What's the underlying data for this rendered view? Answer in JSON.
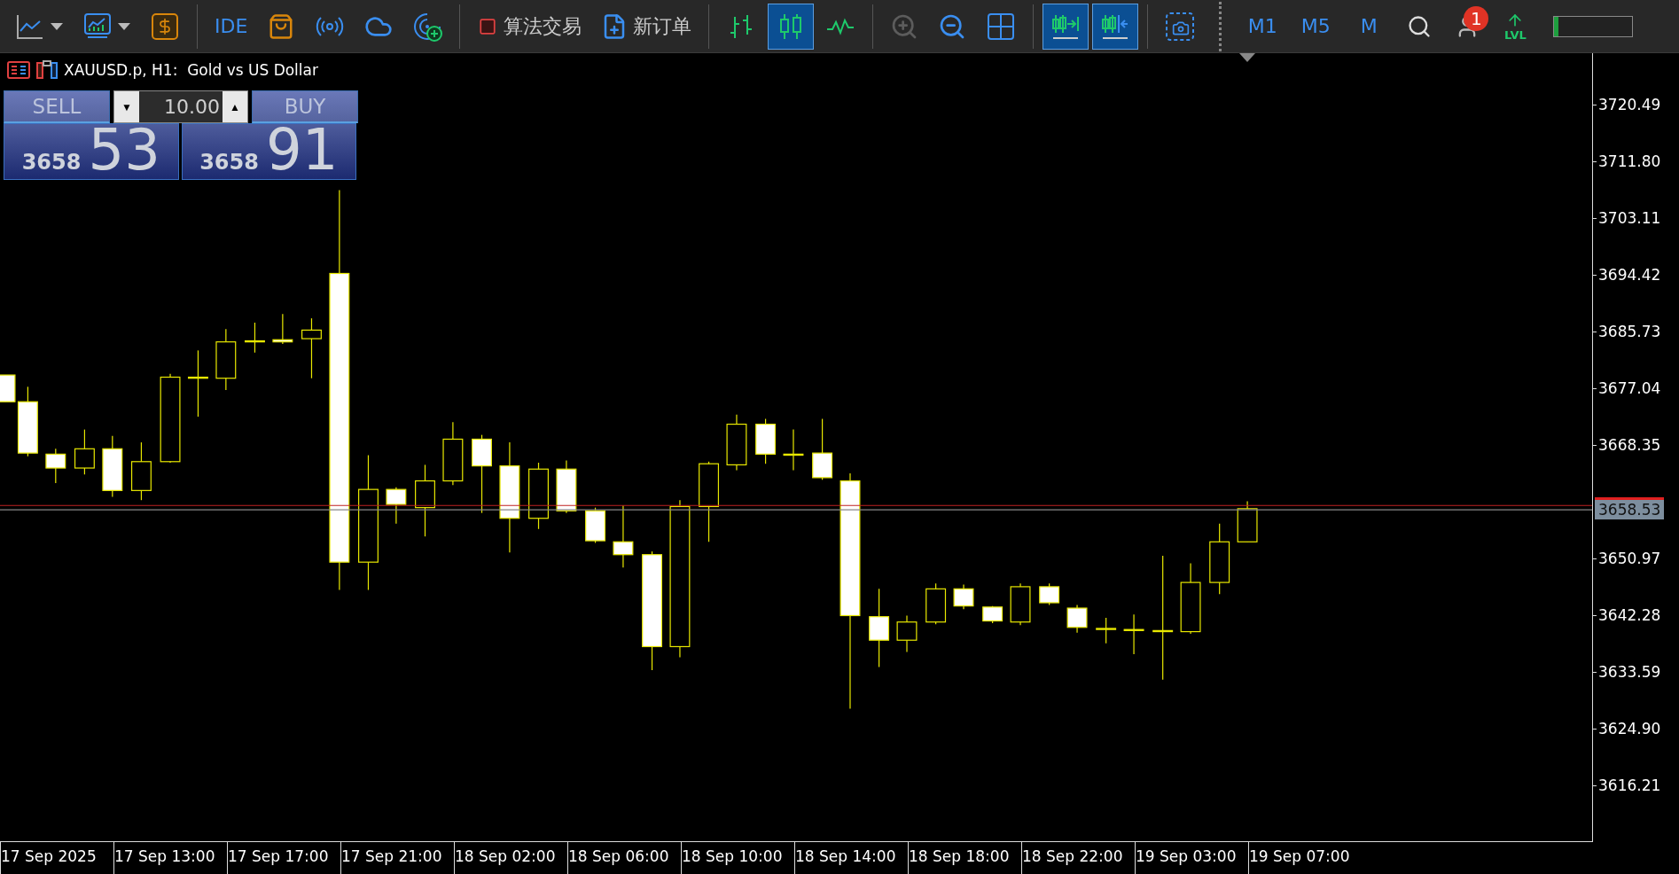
{
  "toolbar": [
    {
      "kind": "linechart",
      "selected": false,
      "disabled": false,
      "dropdown": true
    },
    {
      "kind": "indicators",
      "selected": false,
      "disabled": false,
      "dropdown": true
    },
    {
      "kind": "dollar",
      "selected": false,
      "disabled": false
    },
    {
      "kind": "separator"
    },
    {
      "kind": "text",
      "label": "IDE",
      "selected": false,
      "disabled": false
    },
    {
      "kind": "market",
      "selected": false,
      "disabled": false
    },
    {
      "kind": "signals",
      "selected": false,
      "disabled": false
    },
    {
      "kind": "cloud",
      "selected": false,
      "disabled": false
    },
    {
      "kind": "radar",
      "selected": false,
      "disabled": false
    },
    {
      "kind": "separator"
    },
    {
      "kind": "algo",
      "label": "算法交易",
      "selected": false,
      "disabled": false
    },
    {
      "kind": "neworder",
      "label": "新订单",
      "selected": false,
      "disabled": false
    },
    {
      "kind": "separator"
    },
    {
      "kind": "bars",
      "selected": false,
      "disabled": false
    },
    {
      "kind": "candles",
      "selected": true,
      "disabled": false
    },
    {
      "kind": "line",
      "selected": false,
      "disabled": false
    },
    {
      "kind": "separator"
    },
    {
      "kind": "zoomin",
      "selected": false,
      "disabled": true
    },
    {
      "kind": "zoomout",
      "selected": false,
      "disabled": false
    },
    {
      "kind": "tile",
      "selected": false,
      "disabled": false
    },
    {
      "kind": "separator"
    },
    {
      "kind": "autoscroll",
      "selected": true,
      "disabled": false
    },
    {
      "kind": "shift",
      "selected": true,
      "disabled": false
    },
    {
      "kind": "separator"
    },
    {
      "kind": "screenshot",
      "selected": false,
      "disabled": false
    },
    {
      "kind": "dotted"
    },
    {
      "kind": "timeframe",
      "label": "M1",
      "selected": false,
      "disabled": false
    },
    {
      "kind": "timeframe",
      "label": "M5",
      "selected": false,
      "disabled": false
    },
    {
      "kind": "timeframe",
      "label": "M",
      "selected": false,
      "disabled": false
    },
    {
      "kind": "search",
      "selected": false,
      "disabled": false
    },
    {
      "kind": "account",
      "badge": "1",
      "selected": false,
      "disabled": false
    },
    {
      "kind": "level",
      "label": "LVL",
      "selected": false,
      "disabled": false
    },
    {
      "kind": "meter",
      "level": 0.05
    }
  ],
  "chart": {
    "title": "XAUUSD.p, H1:  Gold vs US Dollar",
    "trade_panel": {
      "sell_label": "SELL",
      "buy_label": "BUY",
      "lot_down": "▼",
      "lot_value": "10.00",
      "lot_up": "▲",
      "bid_big": "3658",
      "bid_small": "53",
      "ask_big": "3658",
      "ask_small": "91"
    },
    "price_axis_upper": [
      "3720.49",
      "3711.80",
      "3703.11",
      "3694.42",
      "3685.73",
      "3677.04",
      "3668.35"
    ],
    "current_price": "3658.53",
    "price_axis_lower": [
      "3650.97",
      "3642.28",
      "3633.59",
      "3624.90",
      "3616.21"
    ],
    "time_axis": [
      "17 Sep 2025",
      "17 Sep 13:00",
      "17 Sep 17:00",
      "17 Sep 21:00",
      "18 Sep 02:00",
      "18 Sep 06:00",
      "18 Sep 10:00",
      "18 Sep 14:00",
      "18 Sep 18:00",
      "18 Sep 22:00",
      "19 Sep 03:00",
      "19 Sep 07:00"
    ]
  }
}
